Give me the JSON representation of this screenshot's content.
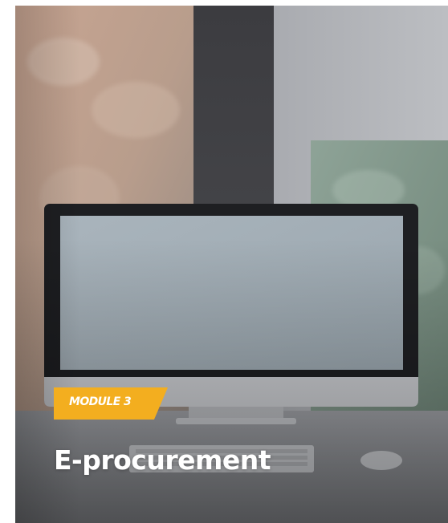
{
  "card": {
    "module_label": "MODULE 3",
    "title": "E-procurement"
  },
  "colors": {
    "tag_background": "#f3ae1f",
    "text": "#ffffff"
  },
  "image": {
    "subject": "desktop-monitor-on-desk"
  }
}
